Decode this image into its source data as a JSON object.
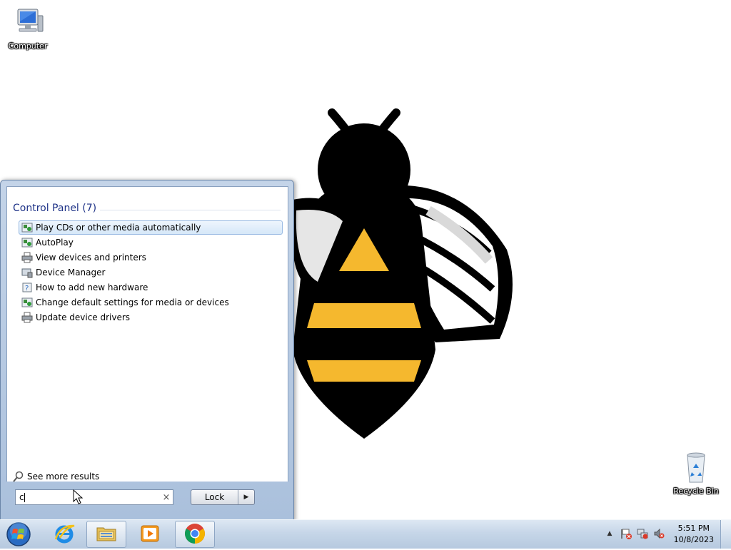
{
  "desktop": {
    "icons": [
      {
        "label": "Computer"
      },
      {
        "label": "Recycle Bin"
      }
    ]
  },
  "start_menu": {
    "group_title": "Control Panel (7)",
    "results": [
      {
        "label": "Play CDs or other media automatically",
        "icon": "autoplay-icon",
        "selected": true
      },
      {
        "label": "AutoPlay",
        "icon": "autoplay-icon",
        "selected": false
      },
      {
        "label": "View devices and printers",
        "icon": "printer-icon",
        "selected": false
      },
      {
        "label": "Device Manager",
        "icon": "device-manager-icon",
        "selected": false
      },
      {
        "label": "How to add new hardware",
        "icon": "help-hardware-icon",
        "selected": false
      },
      {
        "label": "Change default settings for media or devices",
        "icon": "autoplay-icon",
        "selected": false
      },
      {
        "label": "Update device drivers",
        "icon": "printer-icon",
        "selected": false
      }
    ],
    "see_more": "See more results",
    "search": {
      "value": "c",
      "clear_glyph": "×"
    },
    "power_button": {
      "label": "Lock",
      "arrow": "▶"
    }
  },
  "taskbar": {
    "pinned": [
      {
        "name": "internet-explorer",
        "open": false
      },
      {
        "name": "windows-explorer",
        "open": true
      },
      {
        "name": "windows-media-player",
        "open": false
      },
      {
        "name": "google-chrome",
        "open": true
      }
    ],
    "tray": {
      "show_hidden_glyph": "▲",
      "time": "5:51 PM",
      "date": "10/8/2023"
    }
  },
  "colors": {
    "accent_heading": "#1e3287",
    "selection": "#d5e7f8",
    "bee_yellow": "#f5b82e"
  }
}
